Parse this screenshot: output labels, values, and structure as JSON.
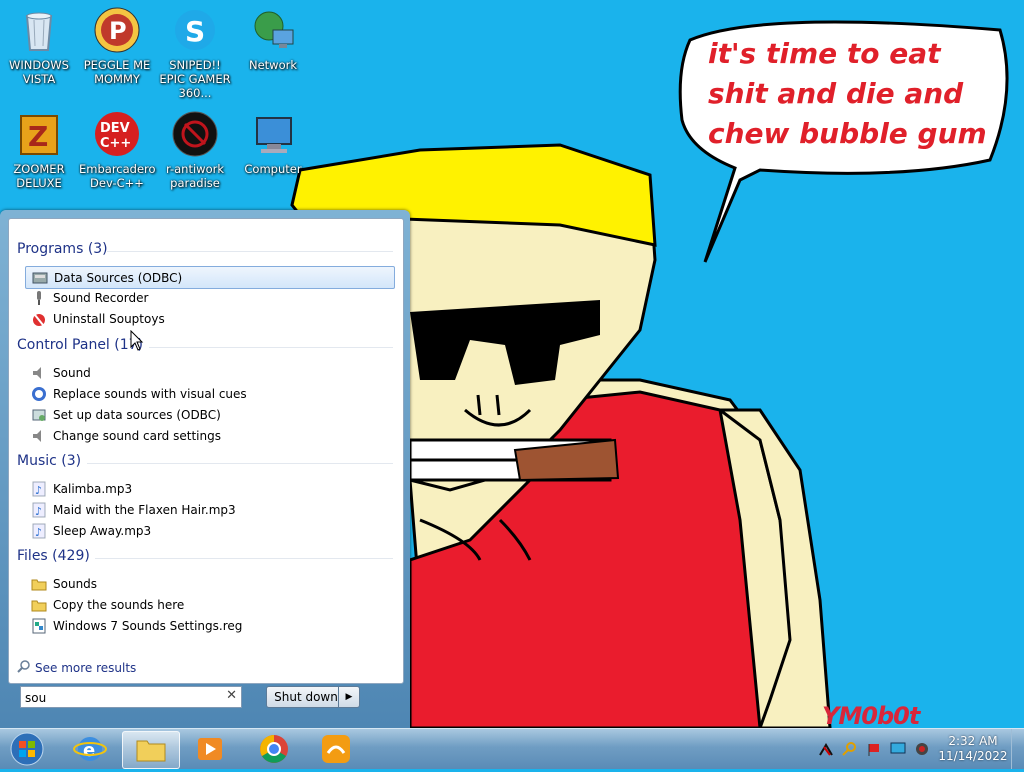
{
  "desktop": {
    "icons": [
      {
        "label": "WINDOWS VISTA"
      },
      {
        "label": "PEGGLE ME MOMMY"
      },
      {
        "label": "SNIPED!! EPIC GAMER 360..."
      },
      {
        "label": "Network"
      },
      {
        "label": "ZOOMER DELUXE"
      },
      {
        "label": "Embarcadero Dev-C++"
      },
      {
        "label": "r-antiwork paradise"
      },
      {
        "label": "Computer"
      }
    ]
  },
  "wallpaper": {
    "speech_text": "it's time to eat shit and die and chew bubble gum",
    "signature": "YM0b0t"
  },
  "start_menu": {
    "groups": [
      {
        "header": "Programs (3)",
        "items": [
          {
            "label": "Data Sources (ODBC)",
            "icon": "odbc-icon"
          },
          {
            "label": "Sound Recorder",
            "icon": "microphone-icon"
          },
          {
            "label": "Uninstall Souptoys",
            "icon": "uninstall-icon"
          }
        ]
      },
      {
        "header": "Control Panel (17)",
        "items": [
          {
            "label": "Sound",
            "icon": "speaker-icon"
          },
          {
            "label": "Replace sounds with visual cues",
            "icon": "ease-of-access-icon"
          },
          {
            "label": "Set up data sources (ODBC)",
            "icon": "odbc-settings-icon"
          },
          {
            "label": "Change sound card settings",
            "icon": "speaker-icon"
          }
        ]
      },
      {
        "header": "Music (3)",
        "items": [
          {
            "label": "Kalimba.mp3",
            "icon": "music-file-icon"
          },
          {
            "label": "Maid with the Flaxen Hair.mp3",
            "icon": "music-file-icon"
          },
          {
            "label": "Sleep Away.mp3",
            "icon": "music-file-icon"
          }
        ]
      },
      {
        "header": "Files (429)",
        "items": [
          {
            "label": "Sounds",
            "icon": "folder-icon"
          },
          {
            "label": "Copy the sounds here",
            "icon": "folder-icon"
          },
          {
            "label": "Windows 7 Sounds Settings.reg",
            "icon": "registry-file-icon"
          }
        ]
      }
    ],
    "see_more": "See more results",
    "search_value": "sou",
    "shutdown_label": "Shut down"
  },
  "taskbar": {
    "clock_time": "2:32 AM",
    "clock_date": "11/14/2022"
  }
}
